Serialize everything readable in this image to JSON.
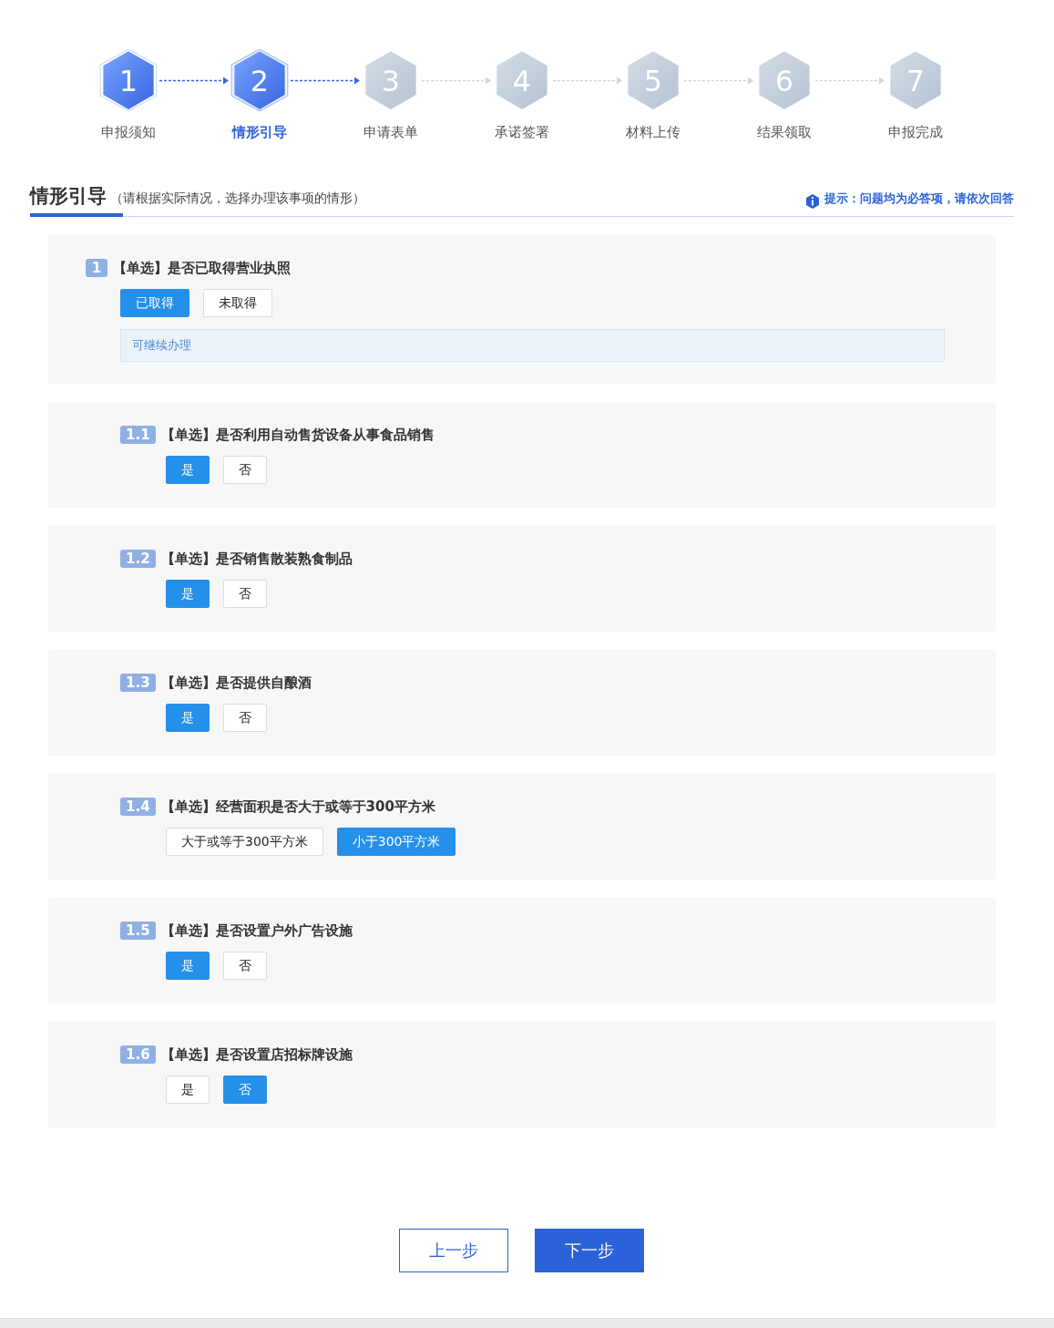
{
  "steps": [
    {
      "number": "1",
      "label": "申报须知",
      "done": true,
      "selected": false
    },
    {
      "number": "2",
      "label": "情形引导",
      "done": false,
      "selected": true
    },
    {
      "number": "3",
      "label": "申请表单",
      "done": false,
      "selected": false
    },
    {
      "number": "4",
      "label": "承诺签署",
      "done": false,
      "selected": false
    },
    {
      "number": "5",
      "label": "材料上传",
      "done": false,
      "selected": false
    },
    {
      "number": "6",
      "label": "结果领取",
      "done": false,
      "selected": false
    },
    {
      "number": "7",
      "label": "申报完成",
      "done": false,
      "selected": false
    }
  ],
  "section": {
    "title": "情形引导",
    "subtitle": "（请根据实际情况，选择办理该事项的情形）",
    "hint": "提示：问题均为必答项，请依次回答"
  },
  "questions": [
    {
      "number": "1",
      "text": "【单选】是否已取得营业执照",
      "options": [
        {
          "label": "已取得",
          "selected": true
        },
        {
          "label": "未取得",
          "selected": false
        }
      ],
      "note": "可继续办理",
      "children": [
        {
          "number": "1.1",
          "text": "【单选】是否利用自动售货设备从事食品销售",
          "options": [
            {
              "label": "是",
              "selected": true
            },
            {
              "label": "否",
              "selected": false
            }
          ]
        },
        {
          "number": "1.2",
          "text": "【单选】是否销售散装熟食制品",
          "options": [
            {
              "label": "是",
              "selected": true
            },
            {
              "label": "否",
              "selected": false
            }
          ]
        },
        {
          "number": "1.3",
          "text": "【单选】是否提供自酿酒",
          "options": [
            {
              "label": "是",
              "selected": true
            },
            {
              "label": "否",
              "selected": false
            }
          ]
        },
        {
          "number": "1.4",
          "text": "【单选】经营面积是否大于或等于300平方米",
          "options": [
            {
              "label": "大于或等于300平方米",
              "selected": false
            },
            {
              "label": "小于300平方米",
              "selected": true
            }
          ]
        },
        {
          "number": "1.5",
          "text": "【单选】是否设置户外广告设施",
          "options": [
            {
              "label": "是",
              "selected": true
            },
            {
              "label": "否",
              "selected": false
            }
          ]
        },
        {
          "number": "1.6",
          "text": "【单选】是否设置店招标牌设施",
          "options": [
            {
              "label": "是",
              "selected": false
            },
            {
              "label": "否",
              "selected": true
            }
          ]
        }
      ]
    }
  ],
  "footer": {
    "prev": "上一步",
    "next": "下一步"
  }
}
